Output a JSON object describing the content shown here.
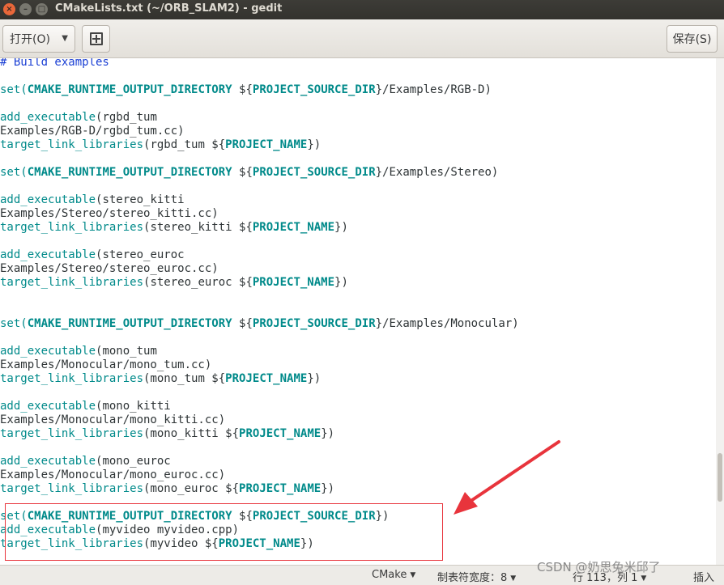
{
  "window": {
    "title": "CMakeLists.txt (~/ORB_SLAM2) - gedit",
    "close_glyph": "×",
    "minimize_glyph": "–",
    "maximize_glyph": "□"
  },
  "toolbar": {
    "open_label": "打开(O)",
    "open_arrow": "▼",
    "save_label": "保存(S)"
  },
  "editor": {
    "language": "CMake",
    "lines": [
      [
        {
          "t": "# Build examples",
          "c": "comment"
        }
      ],
      [],
      [
        {
          "t": "set",
          "c": "fn"
        },
        {
          "t": "(",
          "c": "fn"
        },
        {
          "t": "CMAKE_RUNTIME_OUTPUT_DIRECTORY",
          "c": "var"
        },
        {
          "t": " ${",
          "c": ""
        },
        {
          "t": "PROJECT_SOURCE_DIR",
          "c": "var"
        },
        {
          "t": "}/Examples/RGB-D)",
          "c": ""
        }
      ],
      [],
      [
        {
          "t": "add_executable",
          "c": "fn"
        },
        {
          "t": "(rgbd_tum",
          "c": ""
        }
      ],
      [
        {
          "t": "Examples/RGB-D/rgbd_tum.cc)",
          "c": ""
        }
      ],
      [
        {
          "t": "target_link_libraries",
          "c": "fn"
        },
        {
          "t": "(rgbd_tum ${",
          "c": ""
        },
        {
          "t": "PROJECT_NAME",
          "c": "var"
        },
        {
          "t": "})",
          "c": ""
        }
      ],
      [],
      [
        {
          "t": "set",
          "c": "fn"
        },
        {
          "t": "(",
          "c": "fn"
        },
        {
          "t": "CMAKE_RUNTIME_OUTPUT_DIRECTORY",
          "c": "var"
        },
        {
          "t": " ${",
          "c": ""
        },
        {
          "t": "PROJECT_SOURCE_DIR",
          "c": "var"
        },
        {
          "t": "}/Examples/Stereo)",
          "c": ""
        }
      ],
      [],
      [
        {
          "t": "add_executable",
          "c": "fn"
        },
        {
          "t": "(stereo_kitti",
          "c": ""
        }
      ],
      [
        {
          "t": "Examples/Stereo/stereo_kitti.cc)",
          "c": ""
        }
      ],
      [
        {
          "t": "target_link_libraries",
          "c": "fn"
        },
        {
          "t": "(stereo_kitti ${",
          "c": ""
        },
        {
          "t": "PROJECT_NAME",
          "c": "var"
        },
        {
          "t": "})",
          "c": ""
        }
      ],
      [],
      [
        {
          "t": "add_executable",
          "c": "fn"
        },
        {
          "t": "(stereo_euroc",
          "c": ""
        }
      ],
      [
        {
          "t": "Examples/Stereo/stereo_euroc.cc)",
          "c": ""
        }
      ],
      [
        {
          "t": "target_link_libraries",
          "c": "fn"
        },
        {
          "t": "(stereo_euroc ${",
          "c": ""
        },
        {
          "t": "PROJECT_NAME",
          "c": "var"
        },
        {
          "t": "})",
          "c": ""
        }
      ],
      [],
      [],
      [
        {
          "t": "set",
          "c": "fn"
        },
        {
          "t": "(",
          "c": "fn"
        },
        {
          "t": "CMAKE_RUNTIME_OUTPUT_DIRECTORY",
          "c": "var"
        },
        {
          "t": " ${",
          "c": ""
        },
        {
          "t": "PROJECT_SOURCE_DIR",
          "c": "var"
        },
        {
          "t": "}/Examples/Monocular)",
          "c": ""
        }
      ],
      [],
      [
        {
          "t": "add_executable",
          "c": "fn"
        },
        {
          "t": "(mono_tum",
          "c": ""
        }
      ],
      [
        {
          "t": "Examples/Monocular/mono_tum.cc)",
          "c": ""
        }
      ],
      [
        {
          "t": "target_link_libraries",
          "c": "fn"
        },
        {
          "t": "(mono_tum ${",
          "c": ""
        },
        {
          "t": "PROJECT_NAME",
          "c": "var"
        },
        {
          "t": "})",
          "c": ""
        }
      ],
      [],
      [
        {
          "t": "add_executable",
          "c": "fn"
        },
        {
          "t": "(mono_kitti",
          "c": ""
        }
      ],
      [
        {
          "t": "Examples/Monocular/mono_kitti.cc)",
          "c": ""
        }
      ],
      [
        {
          "t": "target_link_libraries",
          "c": "fn"
        },
        {
          "t": "(mono_kitti ${",
          "c": ""
        },
        {
          "t": "PROJECT_NAME",
          "c": "var"
        },
        {
          "t": "})",
          "c": ""
        }
      ],
      [],
      [
        {
          "t": "add_executable",
          "c": "fn"
        },
        {
          "t": "(mono_euroc",
          "c": ""
        }
      ],
      [
        {
          "t": "Examples/Monocular/mono_euroc.cc)",
          "c": ""
        }
      ],
      [
        {
          "t": "target_link_libraries",
          "c": "fn"
        },
        {
          "t": "(mono_euroc ${",
          "c": ""
        },
        {
          "t": "PROJECT_NAME",
          "c": "var"
        },
        {
          "t": "})",
          "c": ""
        }
      ],
      [],
      [
        {
          "t": "set",
          "c": "fn"
        },
        {
          "t": "(",
          "c": "fn"
        },
        {
          "t": "CMAKE_RUNTIME_OUTPUT_DIRECTORY",
          "c": "var"
        },
        {
          "t": " ${",
          "c": ""
        },
        {
          "t": "PROJECT_SOURCE_DIR",
          "c": "var"
        },
        {
          "t": "})",
          "c": ""
        }
      ],
      [
        {
          "t": "add_executable",
          "c": "fn"
        },
        {
          "t": "(myvideo myvideo.cpp)",
          "c": ""
        }
      ],
      [
        {
          "t": "target_link_libraries",
          "c": "fn"
        },
        {
          "t": "(myvideo ${",
          "c": ""
        },
        {
          "t": "PROJECT_NAME",
          "c": "var"
        },
        {
          "t": "})",
          "c": ""
        }
      ]
    ]
  },
  "statusbar": {
    "language_label": "CMake",
    "tab_width_label": "制表符宽度：8",
    "position_label": "行 113，列 1",
    "insert_mode_label": "插入",
    "dropdown_glyph": "▼"
  },
  "watermark": "CSDN @奶思兔米邱了",
  "colors": {
    "function": "#008a8a",
    "variable": "#008a8a",
    "comment": "#1a3fd4",
    "annotation": "#e8343c",
    "titlebar": "#3d3c37"
  },
  "icons": {
    "close": "close-icon",
    "minimize": "minimize-icon",
    "maximize": "maximize-icon",
    "new_tab": "new-tab-icon",
    "dropdown": "chevron-down-icon"
  }
}
